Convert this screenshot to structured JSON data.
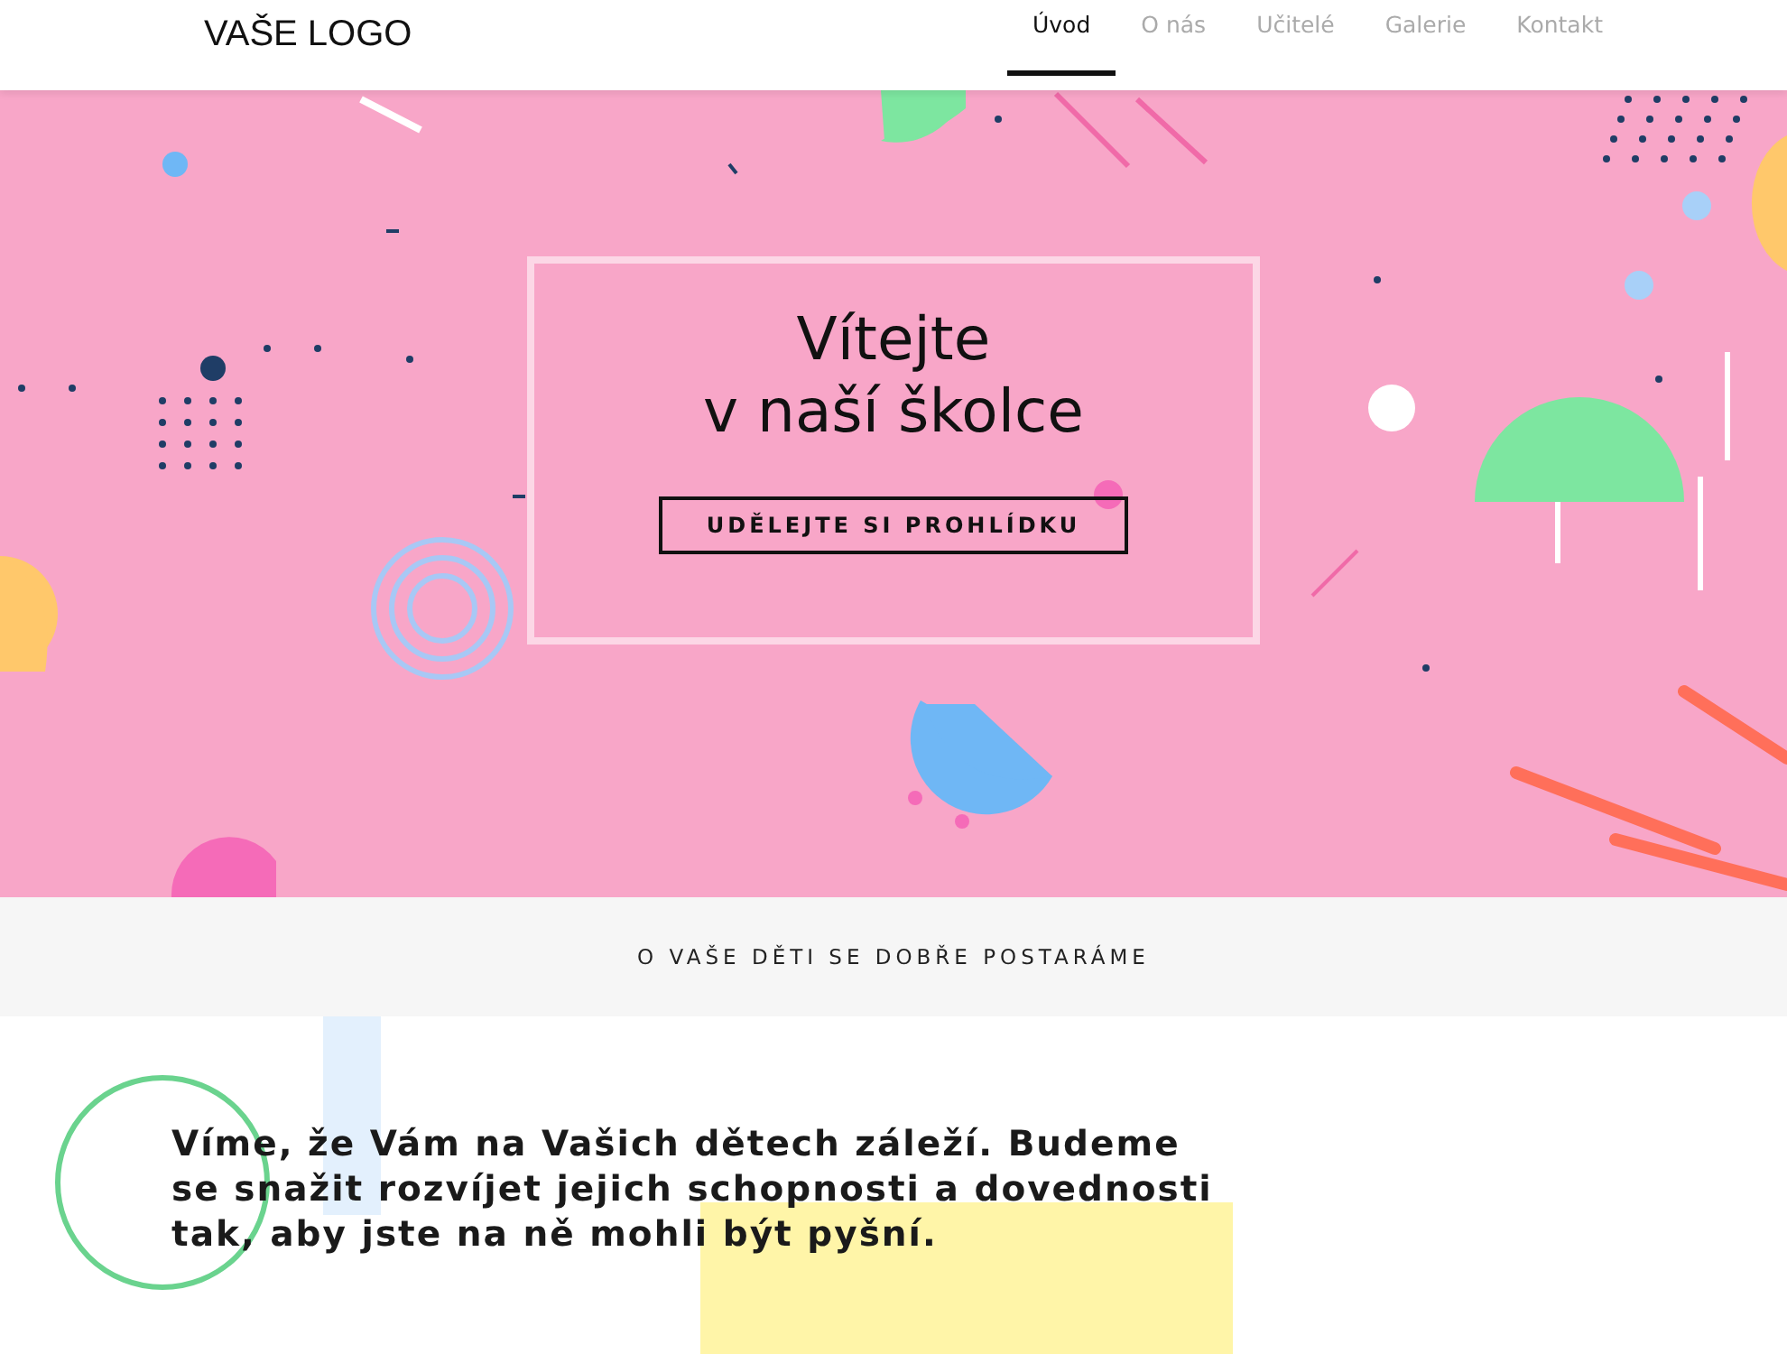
{
  "header": {
    "logo": "VAŠE LOGO",
    "nav": [
      {
        "label": "Úvod",
        "selected": true
      },
      {
        "label": "O nás",
        "selected": false
      },
      {
        "label": "Učitelé",
        "selected": false
      },
      {
        "label": "Galerie",
        "selected": false
      },
      {
        "label": "Kontakt",
        "selected": false
      }
    ]
  },
  "hero": {
    "title_lines": [
      "Vítejte",
      "v naší školce"
    ],
    "button": "UDĚLEJTE SI PROHLÍDKU"
  },
  "band": {
    "text": "O VAŠE DĚTI SE DOBŘE POSTARÁME"
  },
  "intro": {
    "text": "Víme, že Vám na Vašich dětech záleží. Budeme se snažit rozvíjet jejich schopnosti a dovednosti tak, aby jste na ně mohli být pyšní."
  }
}
